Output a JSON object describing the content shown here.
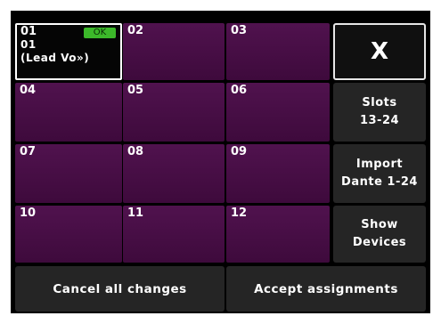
{
  "slots": [
    {
      "number": "01",
      "status": "OK",
      "line2": "01",
      "line3": "(Lead Vo»)"
    },
    {
      "number": "02"
    },
    {
      "number": "03"
    },
    {
      "number": "04"
    },
    {
      "number": "05"
    },
    {
      "number": "06"
    },
    {
      "number": "07"
    },
    {
      "number": "08"
    },
    {
      "number": "09"
    },
    {
      "number": "10"
    },
    {
      "number": "11"
    },
    {
      "number": "12"
    }
  ],
  "sidebar": {
    "close_label": "X",
    "slots_label": "Slots\n13-24",
    "import_label": "Import\nDante 1-24",
    "show_devices_label": "Show\nDevices"
  },
  "footer": {
    "cancel_label": "Cancel all changes",
    "accept_label": "Accept assignments"
  },
  "colors": {
    "slot_fill": "#4a0f47",
    "ok_badge": "#3cb82a",
    "button_fill": "#252525",
    "background": "#000000"
  }
}
